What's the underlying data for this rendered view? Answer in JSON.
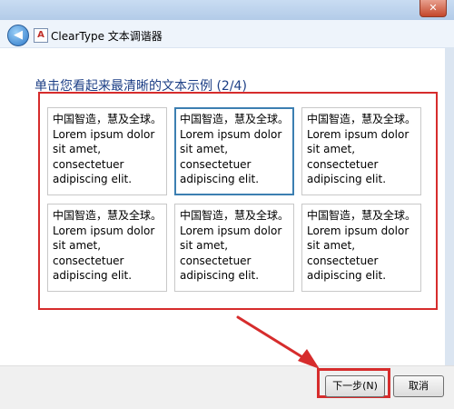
{
  "window": {
    "close_symbol": "✕"
  },
  "header": {
    "back_symbol": "◀",
    "app_icon_label": "A",
    "title": "ClearType 文本调谐器"
  },
  "main": {
    "prompt": "单击您看起来最清晰的文本示例 (2/4)",
    "samples": [
      {
        "cn": "中国智造，慧及全球。",
        "en1": "Lorem ipsum dolor",
        "en2": "sit amet,",
        "en3": "consectetuer",
        "en4": "adipiscing elit.",
        "selected": false
      },
      {
        "cn": "中国智造，慧及全球。",
        "en1": "Lorem ipsum dolor",
        "en2": "sit amet,",
        "en3": "consectetuer",
        "en4": "adipiscing elit.",
        "selected": true
      },
      {
        "cn": "中国智造，慧及全球。",
        "en1": "Lorem ipsum dolor",
        "en2": "sit amet,",
        "en3": "consectetuer",
        "en4": "adipiscing elit.",
        "selected": false
      },
      {
        "cn": "中国智造，慧及全球。",
        "en1": "Lorem ipsum dolor",
        "en2": "sit amet,",
        "en3": "consectetuer",
        "en4": "adipiscing elit.",
        "selected": false
      },
      {
        "cn": "中国智造，慧及全球。",
        "en1": "Lorem ipsum dolor",
        "en2": "sit amet,",
        "en3": "consectetuer",
        "en4": "adipiscing elit.",
        "selected": false
      },
      {
        "cn": "中国智造，慧及全球。",
        "en1": "Lorem ipsum dolor",
        "en2": "sit amet,",
        "en3": "consectetuer",
        "en4": "adipiscing elit.",
        "selected": false
      }
    ]
  },
  "footer": {
    "next_label": "下一步(N)",
    "cancel_label": "取消"
  },
  "annotation": {
    "highlight_color": "#d62c2c"
  }
}
